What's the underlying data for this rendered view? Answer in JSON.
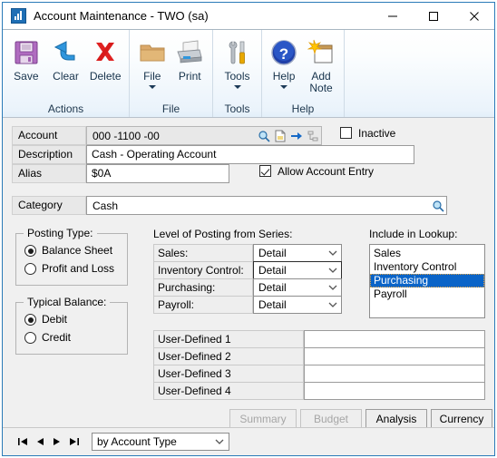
{
  "window": {
    "title": "Account Maintenance  -  TWO (sa)",
    "app_icon": "bar-chart-icon",
    "controls": {
      "minimize": "minimize-icon",
      "maximize": "maximize-icon",
      "close": "close-icon"
    }
  },
  "ribbon": {
    "groups": [
      {
        "name": "Actions",
        "title": "Actions",
        "items": [
          {
            "label": "Save",
            "icon": "floppy-disk-icon",
            "has_menu": false
          },
          {
            "label": "Clear",
            "icon": "undo-arrow-icon",
            "has_menu": false
          },
          {
            "label": "Delete",
            "icon": "red-x-icon",
            "has_menu": false
          }
        ]
      },
      {
        "name": "File",
        "title": "File",
        "items": [
          {
            "label": "File",
            "icon": "folder-icon",
            "has_menu": true
          },
          {
            "label": "Print",
            "icon": "printer-icon",
            "has_menu": false
          }
        ]
      },
      {
        "name": "Tools",
        "title": "Tools",
        "items": [
          {
            "label": "Tools",
            "icon": "wrench-screwdriver-icon",
            "has_menu": true
          }
        ]
      },
      {
        "name": "Help",
        "title": "Help",
        "items": [
          {
            "label": "Help",
            "icon": "blue-question-icon",
            "has_menu": true
          },
          {
            "label": "Add Note",
            "icon": "note-star-icon",
            "has_menu": false
          }
        ]
      }
    ]
  },
  "form": {
    "account": {
      "label": "Account",
      "value": "000 -1100 -00",
      "buttons": [
        "lookup-magnifier-icon",
        "new-document-icon",
        "go-to-arrow-icon",
        "tree-view-icon"
      ]
    },
    "description": {
      "label": "Description",
      "value": "Cash - Operating Account"
    },
    "alias": {
      "label": "Alias",
      "value": "$0A"
    },
    "category": {
      "label": "Category",
      "value": "Cash",
      "lookup_icon": "lookup-magnifier-icon"
    },
    "inactive": {
      "label": "Inactive",
      "checked": false
    },
    "allow_account_entry": {
      "label": "Allow Account Entry",
      "checked": true
    },
    "posting_type": {
      "title": "Posting Type:",
      "options": [
        "Balance Sheet",
        "Profit and Loss"
      ],
      "selected": "Balance Sheet"
    },
    "typical_balance": {
      "title": "Typical Balance:",
      "options": [
        "Debit",
        "Credit"
      ],
      "selected": "Debit"
    },
    "level_of_posting": {
      "title": "Level of Posting from Series:",
      "rows": [
        {
          "label": "Sales:",
          "value": "Detail"
        },
        {
          "label": "Inventory Control:",
          "value": "Detail"
        },
        {
          "label": "Purchasing:",
          "value": "Detail"
        },
        {
          "label": "Payroll:",
          "value": "Detail"
        }
      ]
    },
    "include_in_lookup": {
      "title": "Include in Lookup:",
      "items": [
        "Sales",
        "Inventory Control",
        "Purchasing",
        "Payroll"
      ],
      "selected": "Purchasing"
    },
    "user_defined": [
      {
        "label": "User-Defined 1",
        "value": ""
      },
      {
        "label": "User-Defined 2",
        "value": ""
      },
      {
        "label": "User-Defined 3",
        "value": ""
      },
      {
        "label": "User-Defined 4",
        "value": ""
      }
    ],
    "buttons": [
      {
        "label": "Summary",
        "enabled": false
      },
      {
        "label": "Budget",
        "enabled": false
      },
      {
        "label": "Analysis",
        "enabled": true
      },
      {
        "label": "Currency",
        "enabled": true
      }
    ]
  },
  "statusbar": {
    "nav": [
      "first-record-icon",
      "previous-record-icon",
      "next-record-icon",
      "last-record-icon"
    ],
    "sort_by": "by Account Type"
  },
  "colors": {
    "window_border": "#2a7ab8",
    "selection": "#0a64c8",
    "ribbon_top": "#ffffff",
    "ribbon_bottom": "#e3eff9",
    "face": "#f0f0f0"
  }
}
